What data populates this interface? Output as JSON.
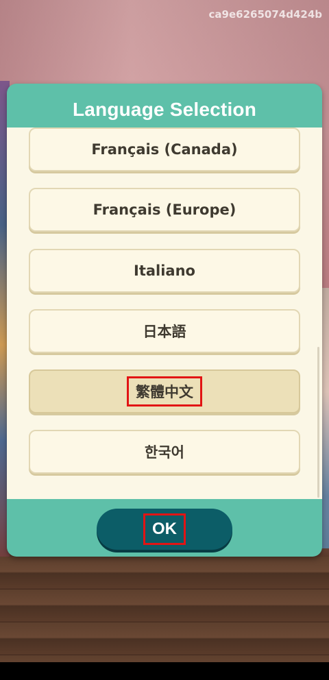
{
  "watermark": "ca9e6265074d424b",
  "dialog": {
    "title": "Language Selection",
    "languages": [
      {
        "label": "Français (Canada)",
        "selected": false
      },
      {
        "label": "Français (Europe)",
        "selected": false
      },
      {
        "label": "Italiano",
        "selected": false
      },
      {
        "label": "日本語",
        "selected": false
      },
      {
        "label": "繁體中文",
        "selected": true
      },
      {
        "label": "한국어",
        "selected": false
      }
    ],
    "ok_label": "OK"
  },
  "colors": {
    "dialog_bg": "#5ec0a9",
    "panel_bg": "#fbf7e6",
    "selected_bg": "#ece0b8",
    "ok_bg": "#0c5d67",
    "highlight": "#e21414"
  }
}
